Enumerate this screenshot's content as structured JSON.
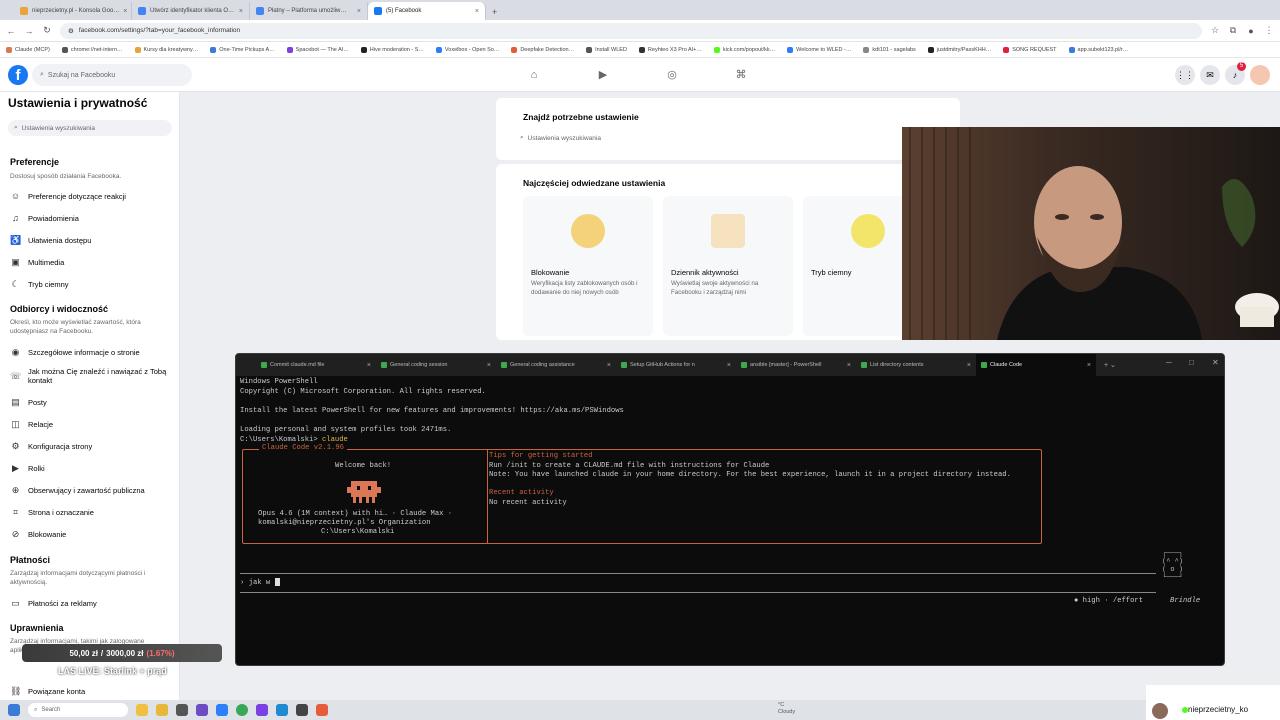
{
  "browser": {
    "tabs": [
      {
        "title": "nieprzecietny.pl - Konsola Goo…",
        "fav": "#e8a33a"
      },
      {
        "title": "Utwórz identyfikator klienta O…",
        "fav": "#4285f4"
      },
      {
        "title": "Płatny – Platforma umożliw…",
        "fav": "#4285f4"
      },
      {
        "title": "(5) Facebook",
        "fav": "#1877f2",
        "active": true
      }
    ],
    "url": "facebook.com/settings/?tab=your_facebook_information",
    "bookmarks": [
      "Claude (MCP)",
      "chrome://net-intern…",
      "Kursy dla kreatywny…",
      "One-Time Pickups A…",
      "Spacebot — The AI…",
      "Hive moderation - S…",
      "Voxelbox - Open So…",
      "Deepfake Detection…",
      "Install WLED",
      "Reyhteo X3 Pro AI+…",
      "kick.com/popout/kk…",
      "Welcome to WLED -…",
      "kdt101 - sagelabs",
      "justdmitry/PassKHH…",
      "SONG REQUEST",
      "app.subekt123.pl/r…"
    ]
  },
  "facebook": {
    "search_placeholder": "Szukaj na Facebooku",
    "notif_count": "5",
    "sidebar": {
      "title": "Ustawienia i prywatność",
      "search_placeholder": "Ustawienia wyszukiwania",
      "sections": {
        "pref": {
          "title": "Preferencje",
          "desc": "Dostosuj sposób działania Facebooka."
        },
        "aud": {
          "title": "Odbiorcy i widoczność",
          "desc": "Określ, kto może wyświetlać zawartość, która udostępniasz na Facebooku."
        },
        "pay": {
          "title": "Płatności",
          "desc": "Zarządzaj informacjami dotyczącymi płatności i aktywnością."
        },
        "perm": {
          "title": "Uprawnienia",
          "desc": "Zarządzaj informacjami, takimi jak zalogowane aplikacje i informacje użytkownika."
        }
      },
      "items": {
        "reactions": "Preferencje dotyczące reakcji",
        "notifications": "Powiadomienia",
        "accessibility": "Ułatwienia dostępu",
        "media": "Multimedia",
        "dark": "Tryb ciemny",
        "profile_info": "Szczegółowe informacje o stronie",
        "find_you": "Jak można Cię znaleźć i nawiązać z Tobą kontakt",
        "posts": "Posty",
        "stories": "Relacje",
        "page_setup": "Konfiguracja strony",
        "roles": "Rolki",
        "followers": "Obserwujący i zawartość publiczna",
        "tagging": "Strona i oznaczanie",
        "blocking": "Blokowanie",
        "ad_payments": "Płatności za reklamy",
        "linked": "Powiązane konta"
      }
    },
    "find_card": {
      "title": "Znajdź potrzebne ustawienie",
      "placeholder": "Ustawienia wyszukiwania"
    },
    "frequent_card": {
      "title": "Najczęściej odwiedzane ustawienia",
      "tiles": [
        {
          "title": "Blokowanie",
          "desc": "Weryfikacja listy zablokowanych osób i dodawanie do niej nowych osób"
        },
        {
          "title": "Dziennik aktywności",
          "desc": "Wyświetlaj swoje aktywności na Facebooku i zarządzaj nimi"
        },
        {
          "title": "Tryb ciemny",
          "desc": ""
        }
      ]
    }
  },
  "terminal": {
    "tabs": [
      "Commit claude.md file",
      "General coding session",
      "General coding assistance",
      "Setup GitHub Actions for n",
      "ansible [master] - PowerShell",
      "List directory contents",
      "Claude Code"
    ],
    "lines": {
      "l1": "Windows PowerShell",
      "l2": "Copyright (C) Microsoft Corporation. All rights reserved.",
      "l3": "Install the latest PowerShell for new features and improvements! https://aka.ms/PSWindows",
      "l4": "Loading personal and system profiles took 2471ms.",
      "l5_path": "C:\\Users\\Komalski>",
      "l5_cmd": " claude"
    },
    "cc": {
      "header": "Claude Code v2.1.96",
      "welcome": "Welcome back!",
      "model": "Opus 4.6 (1M context) with hi… · Claude Max ·",
      "org": "komalski@nieprzecietny.pl's Organization",
      "cwd": "C:\\Users\\Komalski",
      "tips_title": "Tips for getting started",
      "tip1": "Run /init to create a CLAUDE.md file with instructions for Claude",
      "tip2": "Note: You have launched claude in your home directory. For the best experience, launch it in a project directory instead.",
      "recent_title": "Recent activity",
      "recent": "No recent activity"
    },
    "prompt": "jak w",
    "effort": "● high · /effort",
    "mascot": "Brindle"
  },
  "stream": {
    "goal_current": "50,00 zł",
    "goal_sep": "/",
    "goal_total": "3000,00 zł",
    "goal_pct": "(1.67%)",
    "live_text": "LAS LIVE: Starlink + prąd",
    "chat_user": "nieprzecietny_ko"
  },
  "taskbar": {
    "search": "Search",
    "weather_line1": "°C",
    "weather_line2": "Cloudy"
  }
}
